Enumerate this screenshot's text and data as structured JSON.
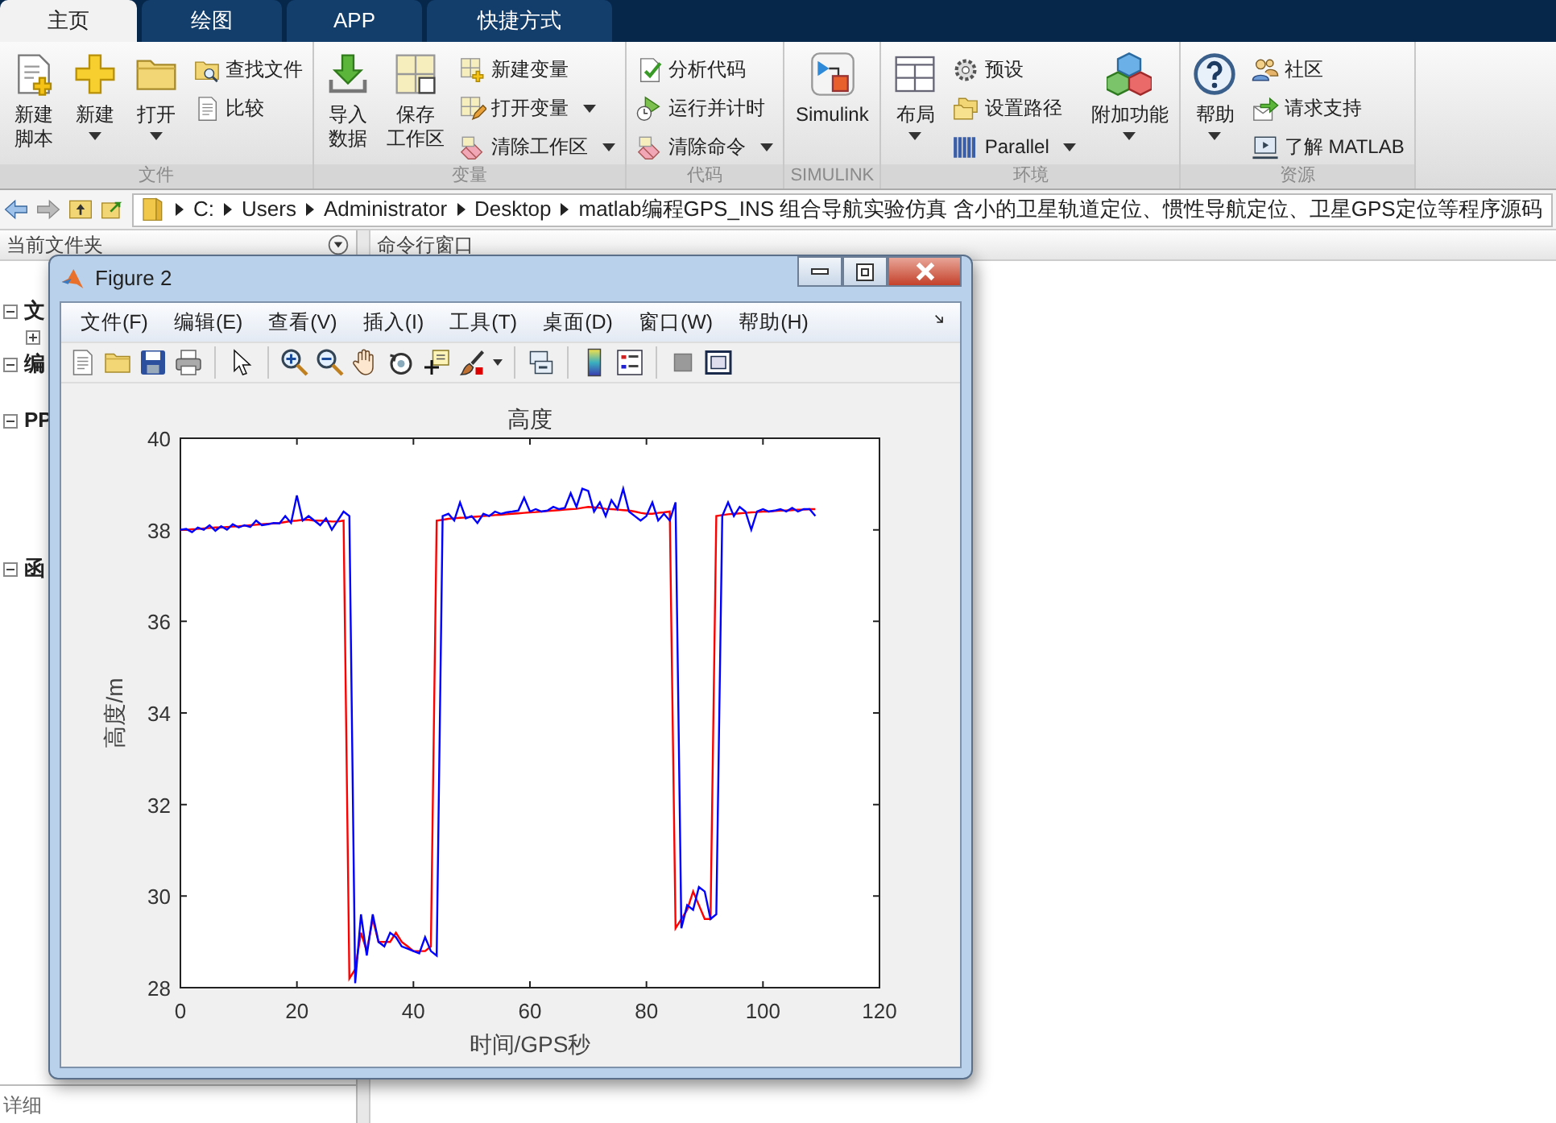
{
  "tabs": [
    {
      "label": "主页",
      "selected": true
    },
    {
      "label": "绘图",
      "selected": false
    },
    {
      "label": "APP",
      "selected": false
    },
    {
      "label": "快捷方式",
      "selected": false
    }
  ],
  "ribbon_groups": [
    {
      "label": "文件",
      "items": [
        {
          "kind": "large",
          "lines": [
            "新建",
            "脚本"
          ],
          "dropdown": false
        },
        {
          "kind": "large",
          "lines": [
            "新建"
          ],
          "dropdown": true
        },
        {
          "kind": "large",
          "lines": [
            "打开"
          ],
          "dropdown": true
        },
        {
          "kind": "stack",
          "items": [
            {
              "label": "查找文件",
              "dropdown": false
            },
            {
              "label": "比较",
              "dropdown": false
            }
          ]
        }
      ]
    },
    {
      "label": "变量",
      "items": [
        {
          "kind": "large",
          "lines": [
            "导入",
            "数据"
          ],
          "dropdown": false
        },
        {
          "kind": "large",
          "lines": [
            "保存",
            "工作区"
          ],
          "dropdown": false
        },
        {
          "kind": "stack",
          "items": [
            {
              "label": "新建变量",
              "dropdown": false
            },
            {
              "label": "打开变量",
              "dropdown": true
            },
            {
              "label": "清除工作区",
              "dropdown": true
            }
          ]
        }
      ]
    },
    {
      "label": "代码",
      "items": [
        {
          "kind": "stack",
          "items": [
            {
              "label": "分析代码",
              "dropdown": false
            },
            {
              "label": "运行并计时",
              "dropdown": false
            },
            {
              "label": "清除命令",
              "dropdown": true
            }
          ]
        }
      ]
    },
    {
      "label": "SIMULINK",
      "items": [
        {
          "kind": "large",
          "lines": [
            "Simulink"
          ],
          "dropdown": false
        }
      ]
    },
    {
      "label": "环境",
      "items": [
        {
          "kind": "large",
          "lines": [
            "布局"
          ],
          "dropdown": true
        },
        {
          "kind": "stack",
          "items": [
            {
              "label": "预设",
              "dropdown": false
            },
            {
              "label": "设置路径",
              "dropdown": false
            },
            {
              "label": "Parallel",
              "dropdown": true
            }
          ]
        },
        {
          "kind": "large",
          "lines": [
            "附加功能"
          ],
          "dropdown": true
        }
      ]
    },
    {
      "label": "资源",
      "items": [
        {
          "kind": "large",
          "lines": [
            "帮助"
          ],
          "dropdown": true
        },
        {
          "kind": "stack",
          "items": [
            {
              "label": "社区",
              "dropdown": false
            },
            {
              "label": "请求支持",
              "dropdown": false
            },
            {
              "label": "了解 MATLAB",
              "dropdown": false
            }
          ]
        }
      ]
    }
  ],
  "address_bar": {
    "path": [
      "C:",
      "Users",
      "Administrator",
      "Desktop",
      "matlab编程GPS_INS 组合导航实验仿真 含小的卫星轨道定位、惯性导航定位、卫星GPS定位等程序源码"
    ]
  },
  "current_folder": {
    "title": "当前文件夹",
    "tree": [
      {
        "label": "文",
        "expanded": true,
        "children": [
          {
            "expanded": false
          }
        ]
      },
      {
        "label": "编",
        "expanded": true
      },
      {
        "label": "PP",
        "expanded": true
      },
      {
        "label": "函",
        "expanded": true
      }
    ],
    "details": "详细"
  },
  "command_window": {
    "title": "命令行窗口"
  },
  "figure": {
    "title": "Figure 2",
    "menu": [
      "文件(F)",
      "编辑(E)",
      "查看(V)",
      "插入(I)",
      "工具(T)",
      "桌面(D)",
      "窗口(W)",
      "帮助(H)"
    ],
    "chart_data": {
      "type": "line",
      "title": "高度",
      "xlabel": "时间/GPS秒",
      "ylabel": "高度/m",
      "xlim": [
        0,
        120
      ],
      "ylim": [
        28,
        40
      ],
      "xticks": [
        0,
        20,
        40,
        60,
        80,
        100,
        120
      ],
      "yticks": [
        28,
        30,
        32,
        34,
        36,
        38,
        40
      ],
      "x": [
        0,
        1,
        2,
        3,
        4,
        5,
        6,
        7,
        8,
        9,
        10,
        11,
        12,
        13,
        14,
        15,
        16,
        17,
        18,
        19,
        20,
        21,
        22,
        23,
        24,
        25,
        26,
        27,
        28,
        29,
        30,
        31,
        32,
        33,
        34,
        35,
        36,
        37,
        38,
        39,
        40,
        41,
        42,
        43,
        44,
        45,
        46,
        47,
        48,
        49,
        50,
        51,
        52,
        53,
        54,
        55,
        56,
        57,
        58,
        59,
        60,
        61,
        62,
        63,
        64,
        65,
        66,
        67,
        68,
        69,
        70,
        71,
        72,
        73,
        74,
        75,
        76,
        77,
        78,
        79,
        80,
        81,
        82,
        83,
        84,
        85,
        86,
        87,
        88,
        89,
        90,
        91,
        92,
        93,
        94,
        95,
        96,
        97,
        98,
        99,
        100,
        101,
        102,
        103,
        104,
        105,
        106,
        107,
        108,
        109
      ],
      "series": [
        {
          "color": "#ff0000",
          "values": [
            38.0,
            38.0,
            38.01,
            38.02,
            38.03,
            38.04,
            38.05,
            38.05,
            38.06,
            38.07,
            38.08,
            38.09,
            38.1,
            38.11,
            38.12,
            38.13,
            38.14,
            38.15,
            38.17,
            38.19,
            38.2,
            38.22,
            38.22,
            38.2,
            38.2,
            38.19,
            38.18,
            38.18,
            38.2,
            28.2,
            28.4,
            29.2,
            28.8,
            29.5,
            29.0,
            29.0,
            29.0,
            29.2,
            29.0,
            28.9,
            28.8,
            28.8,
            28.8,
            28.9,
            38.2,
            38.22,
            38.24,
            38.25,
            38.26,
            38.27,
            38.28,
            38.29,
            38.3,
            38.31,
            38.32,
            38.33,
            38.34,
            38.35,
            38.36,
            38.37,
            38.38,
            38.39,
            38.4,
            38.41,
            38.42,
            38.43,
            38.44,
            38.45,
            38.46,
            38.48,
            38.5,
            38.49,
            38.48,
            38.46,
            38.45,
            38.44,
            38.43,
            38.42,
            38.4,
            38.37,
            38.35,
            38.35,
            38.37,
            38.38,
            38.4,
            29.3,
            29.5,
            29.7,
            30.1,
            29.8,
            29.5,
            29.5,
            38.3,
            38.32,
            38.34,
            38.35,
            38.36,
            38.37,
            38.38,
            38.39,
            38.4,
            38.4,
            38.41,
            38.42,
            38.42,
            38.43,
            38.44,
            38.44,
            38.45,
            38.45
          ]
        },
        {
          "color": "#0000ff",
          "values": [
            38.0,
            38.02,
            37.95,
            38.05,
            38.0,
            38.1,
            37.98,
            38.08,
            38.0,
            38.12,
            38.05,
            38.1,
            38.06,
            38.2,
            38.1,
            38.12,
            38.15,
            38.14,
            38.3,
            38.15,
            38.75,
            38.2,
            38.3,
            38.2,
            38.1,
            38.25,
            38.0,
            38.2,
            38.4,
            38.3,
            28.1,
            29.6,
            28.7,
            29.6,
            29.0,
            28.9,
            29.2,
            29.1,
            28.9,
            28.85,
            28.8,
            28.75,
            29.1,
            28.8,
            28.7,
            38.3,
            38.35,
            38.2,
            38.6,
            38.25,
            38.3,
            38.15,
            38.35,
            38.3,
            38.4,
            38.35,
            38.38,
            38.4,
            38.42,
            38.7,
            38.4,
            38.45,
            38.4,
            38.42,
            38.5,
            38.45,
            38.48,
            38.8,
            38.5,
            38.9,
            38.85,
            38.4,
            38.6,
            38.3,
            38.65,
            38.45,
            38.9,
            38.4,
            38.3,
            38.2,
            38.3,
            38.6,
            38.2,
            38.35,
            38.2,
            38.6,
            29.3,
            29.8,
            29.7,
            30.2,
            30.1,
            29.5,
            29.6,
            38.3,
            38.6,
            38.3,
            38.5,
            38.4,
            38.0,
            38.4,
            38.45,
            38.4,
            38.42,
            38.45,
            38.4,
            38.48,
            38.4,
            38.45,
            38.45,
            38.3
          ]
        }
      ]
    }
  }
}
